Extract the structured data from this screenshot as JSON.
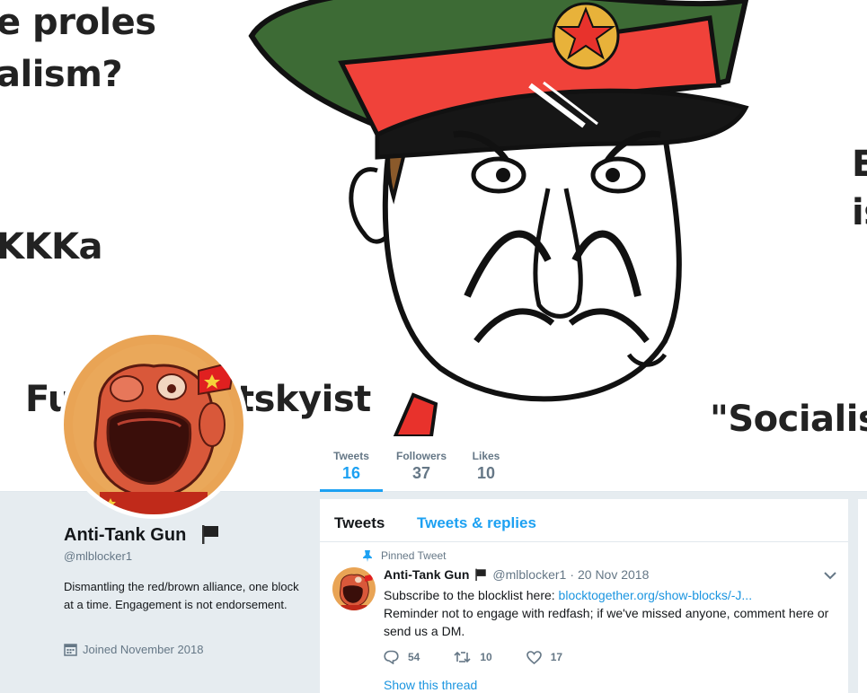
{
  "banner": {
    "texts": [
      "e proles",
      "alism?",
      "KKKa",
      "Fu",
      "tskyist",
      "E",
      "is",
      "\"Socialist"
    ]
  },
  "nav": {
    "stats": [
      {
        "label": "Tweets",
        "value": "16"
      },
      {
        "label": "Followers",
        "value": "37"
      },
      {
        "label": "Likes",
        "value": "10"
      }
    ]
  },
  "profile": {
    "name": "Anti-Tank Gun",
    "handle": "@mlblocker1",
    "bio": "Dismantling the red/brown alliance, one block at a time. Engagement is not endorsement.",
    "joined": "Joined November 2018"
  },
  "timeline": {
    "tabs": [
      "Tweets",
      "Tweets & replies"
    ]
  },
  "tweet": {
    "pinned_label": "Pinned Tweet",
    "name": "Anti-Tank Gun",
    "handle": "@mlblocker1",
    "dot": "·",
    "date": "20 Nov 2018",
    "line1_prefix": "Subscribe to the blocklist here: ",
    "link": "blocktogether.org/show-blocks/-J...",
    "line2": "Reminder not to engage with redfash; if we've missed anyone, comment here or send us a DM.",
    "replies": "54",
    "retweets": "10",
    "likes": "17",
    "show_thread": "Show this thread"
  },
  "icons": {
    "flag": "black-flag-icon",
    "pin": "pin-icon",
    "calendar": "calendar-icon",
    "caret": "chevron-down-icon",
    "reply": "reply-icon",
    "retweet": "retweet-icon",
    "like": "heart-icon"
  },
  "colors": {
    "accent": "#1da1f2",
    "link": "#1b95e0",
    "muted": "#657786",
    "background": "#e6ecf0"
  }
}
